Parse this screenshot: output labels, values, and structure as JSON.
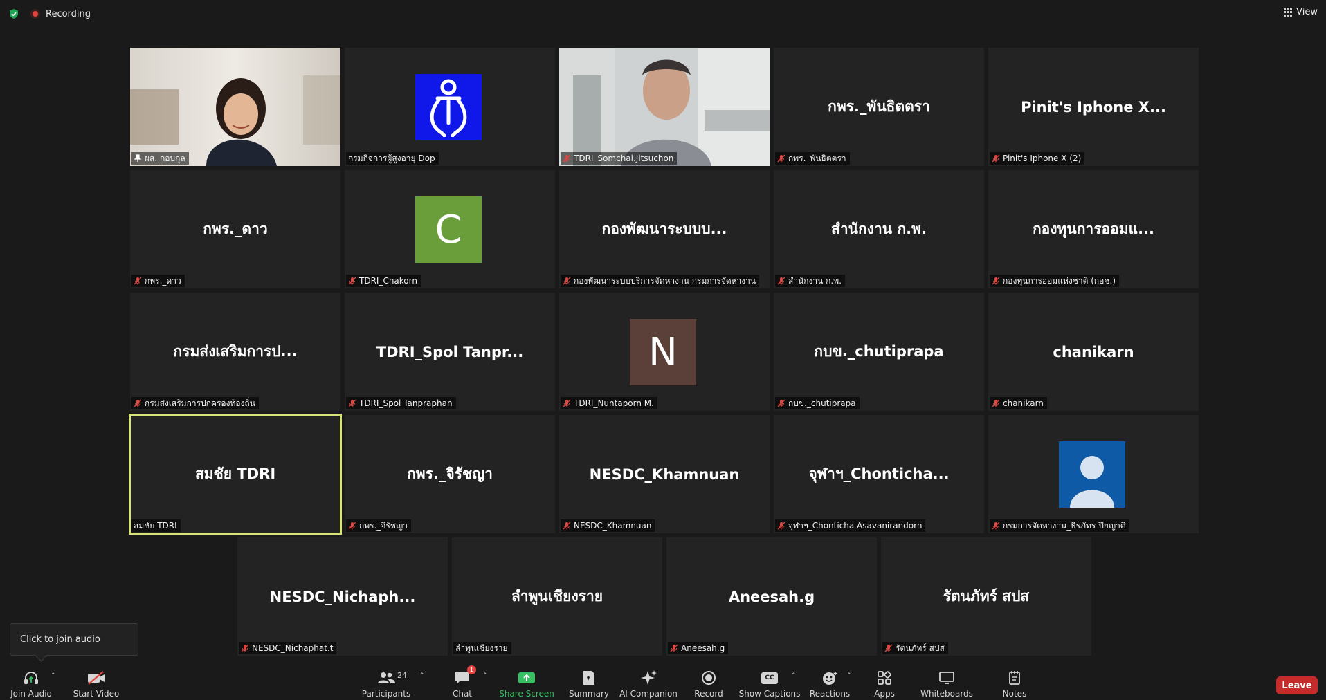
{
  "top": {
    "recording_label": "Recording",
    "view_label": "View"
  },
  "tiles": [
    {
      "big": "",
      "name": "ผส. กอบกุล",
      "muted": false,
      "pinned": true,
      "type": "video-woman"
    },
    {
      "big": "",
      "name": "กรมกิจการผู้สูงอายุ Dop",
      "muted": false,
      "type": "logo-dop"
    },
    {
      "big": "",
      "name": "TDRI_Somchai.Jitsuchon",
      "muted": true,
      "type": "video-man"
    },
    {
      "big": "กพร._พันธิตตรา",
      "name": "กพร._พันธิตตรา",
      "muted": true
    },
    {
      "big": "Pinit's Iphone X...",
      "name": "Pinit's Iphone X (2)",
      "muted": true
    },
    {
      "big": "กพร._ดาว",
      "name": "กพร._ดาว",
      "muted": true
    },
    {
      "big": "C",
      "name": "TDRI_Chakorn",
      "muted": true,
      "type": "avatar",
      "avatar_color": "#6a9e3a"
    },
    {
      "big": "กองพัฒนาระบบบ...",
      "name": "กองพัฒนาระบบบริการจัดหางาน กรมการจัดหางาน",
      "muted": true
    },
    {
      "big": "สำนักงาน ก.พ.",
      "name": "สำนักงาน ก.พ.",
      "muted": true
    },
    {
      "big": "กองทุนการออมแ...",
      "name": "กองทุนการออมแห่งชาติ (กอช.)",
      "muted": true
    },
    {
      "big": "กรมส่งเสริมการป...",
      "name": "กรมส่งเสริมการปกครองท้องถิ่น",
      "muted": true
    },
    {
      "big": "TDRI_Spol Tanpr...",
      "name": "TDRI_Spol Tanpraphan",
      "muted": true
    },
    {
      "big": "N",
      "name": "TDRI_Nuntaporn M.",
      "muted": true,
      "type": "avatar",
      "avatar_color": "#5a4038"
    },
    {
      "big": "กบข._chutiprapa",
      "name": "กบข._chutiprapa",
      "muted": true
    },
    {
      "big": "chanikarn",
      "name": "chanikarn",
      "muted": true
    },
    {
      "big": "สมชัย TDRI",
      "name": "สมชัย TDRI",
      "muted": false,
      "speaking": true
    },
    {
      "big": "กพร._จิรัชญา",
      "name": "กพร._จิรัชญา",
      "muted": true
    },
    {
      "big": "NESDC_Khamnuan",
      "name": "NESDC_Khamnuan",
      "muted": true
    },
    {
      "big": "จุฬาฯ_Chonticha...",
      "name": "จุฬาฯ_Chonticha Asavanirandorn",
      "muted": true
    },
    {
      "big": "",
      "name": "กรมการจัดหางาน_ธีรภัทร ปิยญาติ",
      "muted": true,
      "type": "person-avatar"
    },
    {
      "big": "NESDC_Nichaph...",
      "name": "NESDC_Nichaphat.t",
      "muted": true
    },
    {
      "big": "ลำพูนเชียงราย",
      "name": "ลำพูนเชียงราย",
      "muted": false
    },
    {
      "big": "Aneesah.g",
      "name": "Aneesah.g",
      "muted": true
    },
    {
      "big": "รัตนภัทร์ สปส",
      "name": "รัตนภัทร์ สปส",
      "muted": true
    }
  ],
  "tooltip": "Click to join audio",
  "toolbar": {
    "join_audio": "Join Audio",
    "start_video": "Start Video",
    "participants": "Participants",
    "participants_count": "24",
    "chat": "Chat",
    "chat_badge": "1",
    "share_screen": "Share Screen",
    "summary": "Summary",
    "ai_companion": "AI Companion",
    "record": "Record",
    "show_captions": "Show Captions",
    "captions_icon_text": "CC",
    "reactions": "Reactions",
    "apps": "Apps",
    "whiteboards": "Whiteboards",
    "notes": "Notes",
    "leave": "Leave"
  }
}
